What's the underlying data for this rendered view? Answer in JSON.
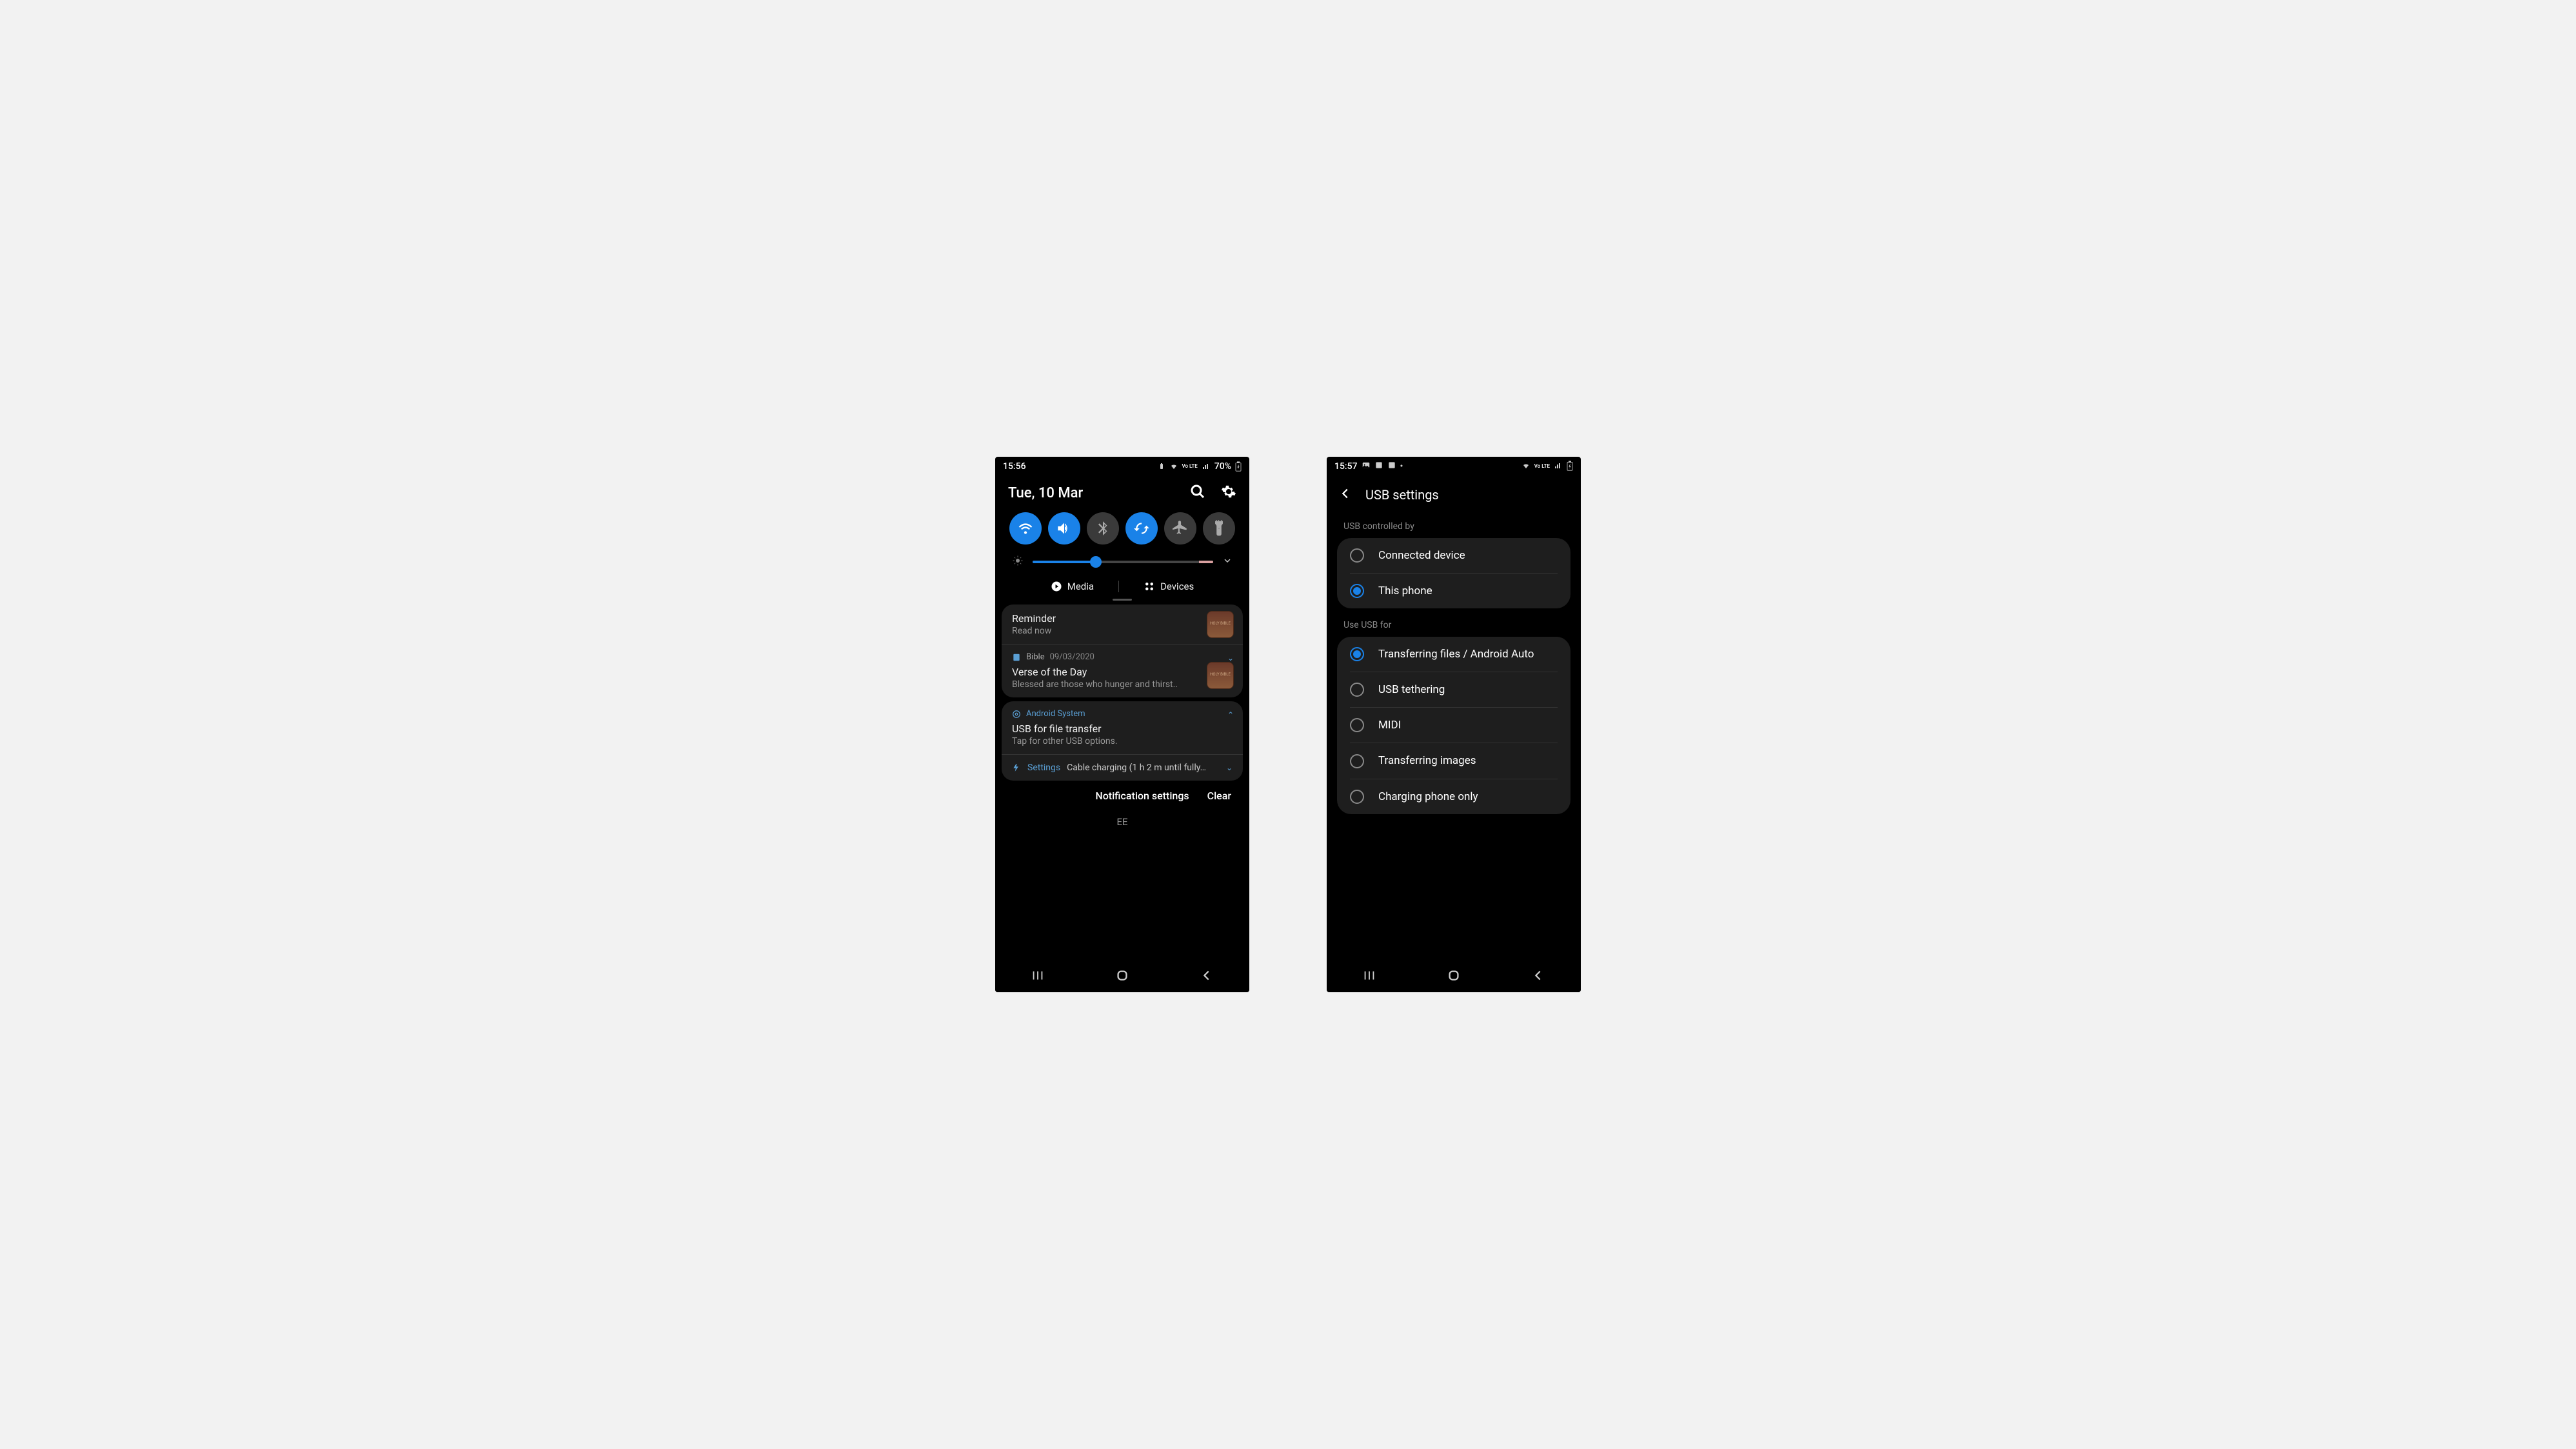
{
  "phone1": {
    "status": {
      "time": "15:56",
      "battery_pct": "70%",
      "volte": "Vo LTE"
    },
    "date": "Tue, 10 Mar",
    "toggles": [
      {
        "name": "wifi",
        "on": true
      },
      {
        "name": "sound",
        "on": true
      },
      {
        "name": "bluetooth",
        "on": false
      },
      {
        "name": "rotate",
        "on": true
      },
      {
        "name": "airplane",
        "on": false
      },
      {
        "name": "flashlight",
        "on": false
      }
    ],
    "brightness_pct": 35,
    "media_label": "Media",
    "devices_label": "Devices",
    "notifications": {
      "reminder": {
        "title": "Reminder",
        "body": "Read now",
        "thumb": "HOLY BIBLE"
      },
      "bible": {
        "app": "Bible",
        "date": "09/03/2020",
        "title": "Verse of the Day",
        "body": "Blessed are those who hunger and thirst..",
        "thumb": "HOLY BIBLE"
      },
      "android_system": {
        "app": "Android System",
        "title": "USB for file transfer",
        "body": "Tap for other USB options."
      },
      "settings": {
        "app": "Settings",
        "text": "Cable charging (1 h 2 m until fully…"
      }
    },
    "footer": {
      "settings": "Notification settings",
      "clear": "Clear"
    },
    "carrier": "EE"
  },
  "phone2": {
    "status": {
      "time": "15:57",
      "volte": "Vo LTE"
    },
    "title": "USB settings",
    "section1_label": "USB controlled by",
    "section1": [
      {
        "label": "Connected device",
        "selected": false
      },
      {
        "label": "This phone",
        "selected": true
      }
    ],
    "section2_label": "Use USB for",
    "section2": [
      {
        "label": "Transferring files / Android Auto",
        "selected": true
      },
      {
        "label": "USB tethering",
        "selected": false
      },
      {
        "label": "MIDI",
        "selected": false
      },
      {
        "label": "Transferring images",
        "selected": false
      },
      {
        "label": "Charging phone only",
        "selected": false
      }
    ]
  }
}
